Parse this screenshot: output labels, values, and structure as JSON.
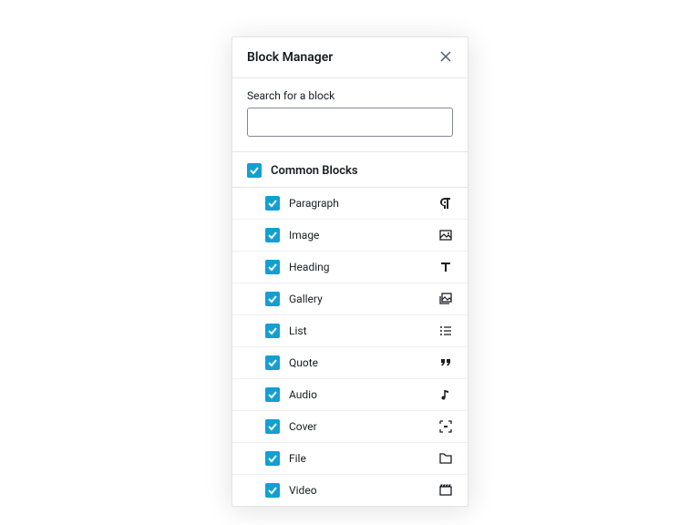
{
  "header": {
    "title": "Block Manager"
  },
  "search": {
    "label": "Search for a block",
    "value": ""
  },
  "category": {
    "title": "Common Blocks",
    "checked": true,
    "blocks": [
      {
        "label": "Paragraph",
        "icon": "paragraph-icon",
        "checked": true
      },
      {
        "label": "Image",
        "icon": "image-icon",
        "checked": true
      },
      {
        "label": "Heading",
        "icon": "heading-icon",
        "checked": true
      },
      {
        "label": "Gallery",
        "icon": "gallery-icon",
        "checked": true
      },
      {
        "label": "List",
        "icon": "list-icon",
        "checked": true
      },
      {
        "label": "Quote",
        "icon": "quote-icon",
        "checked": true
      },
      {
        "label": "Audio",
        "icon": "audio-icon",
        "checked": true
      },
      {
        "label": "Cover",
        "icon": "cover-icon",
        "checked": true
      },
      {
        "label": "File",
        "icon": "file-icon",
        "checked": true
      },
      {
        "label": "Video",
        "icon": "video-icon",
        "checked": true
      }
    ]
  }
}
